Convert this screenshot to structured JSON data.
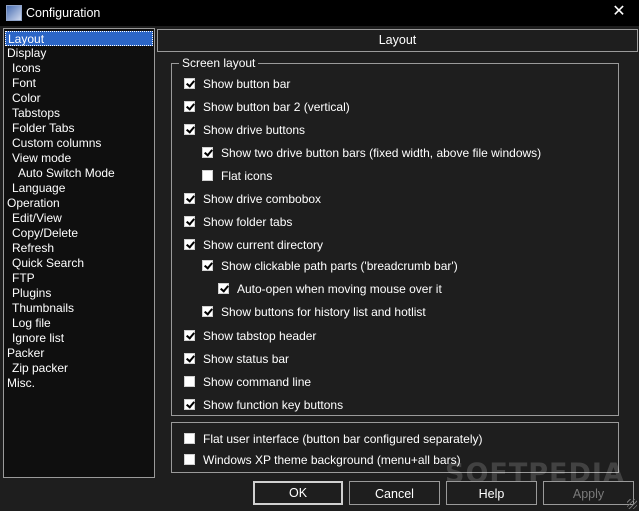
{
  "window": {
    "title": "Configuration",
    "close_glyph": "✕"
  },
  "tree": {
    "items": [
      {
        "label": "Layout",
        "selected": true
      },
      {
        "label": "Display"
      },
      {
        "label": "Icons"
      },
      {
        "label": "Font"
      },
      {
        "label": "Color"
      },
      {
        "label": "Tabstops"
      },
      {
        "label": "Folder Tabs"
      },
      {
        "label": "Custom columns"
      },
      {
        "label": "View mode"
      },
      {
        "label": "Auto Switch Mode"
      },
      {
        "label": "Language"
      },
      {
        "label": "Operation"
      },
      {
        "label": "Edit/View"
      },
      {
        "label": "Copy/Delete"
      },
      {
        "label": "Refresh"
      },
      {
        "label": "Quick Search"
      },
      {
        "label": "FTP"
      },
      {
        "label": "Plugins"
      },
      {
        "label": "Thumbnails"
      },
      {
        "label": "Log file"
      },
      {
        "label": "Ignore list"
      },
      {
        "label": "Packer"
      },
      {
        "label": "Zip packer"
      },
      {
        "label": "Misc."
      }
    ]
  },
  "panel": {
    "header": "Layout",
    "screen_layout": {
      "title": "Screen layout",
      "options": [
        {
          "label": "Show button bar",
          "checked": true
        },
        {
          "label": "Show button bar 2 (vertical)",
          "checked": true
        },
        {
          "label": "Show drive buttons",
          "checked": true
        },
        {
          "label": "Show two drive button bars (fixed width, above file windows)",
          "checked": true
        },
        {
          "label": "Flat icons",
          "checked": false
        },
        {
          "label": "Show drive combobox",
          "checked": true
        },
        {
          "label": "Show folder tabs",
          "checked": true
        },
        {
          "label": "Show current directory",
          "checked": true
        },
        {
          "label": "Show clickable path parts ('breadcrumb bar')",
          "checked": true
        },
        {
          "label": "Auto-open when moving mouse over it",
          "checked": true
        },
        {
          "label": "Show buttons for history list and hotlist",
          "checked": true
        },
        {
          "label": "Show tabstop header",
          "checked": true
        },
        {
          "label": "Show status bar",
          "checked": true
        },
        {
          "label": "Show command line",
          "checked": false
        },
        {
          "label": "Show function key buttons",
          "checked": true
        }
      ]
    },
    "extra_options": [
      {
        "label": "Flat user interface (button bar configured separately)",
        "checked": false
      },
      {
        "label": "Windows XP theme background (menu+all bars)",
        "checked": false
      }
    ]
  },
  "buttons": {
    "ok": "OK",
    "cancel": "Cancel",
    "help": "Help",
    "apply": "Apply"
  },
  "watermark": "SOFTPEDIA"
}
